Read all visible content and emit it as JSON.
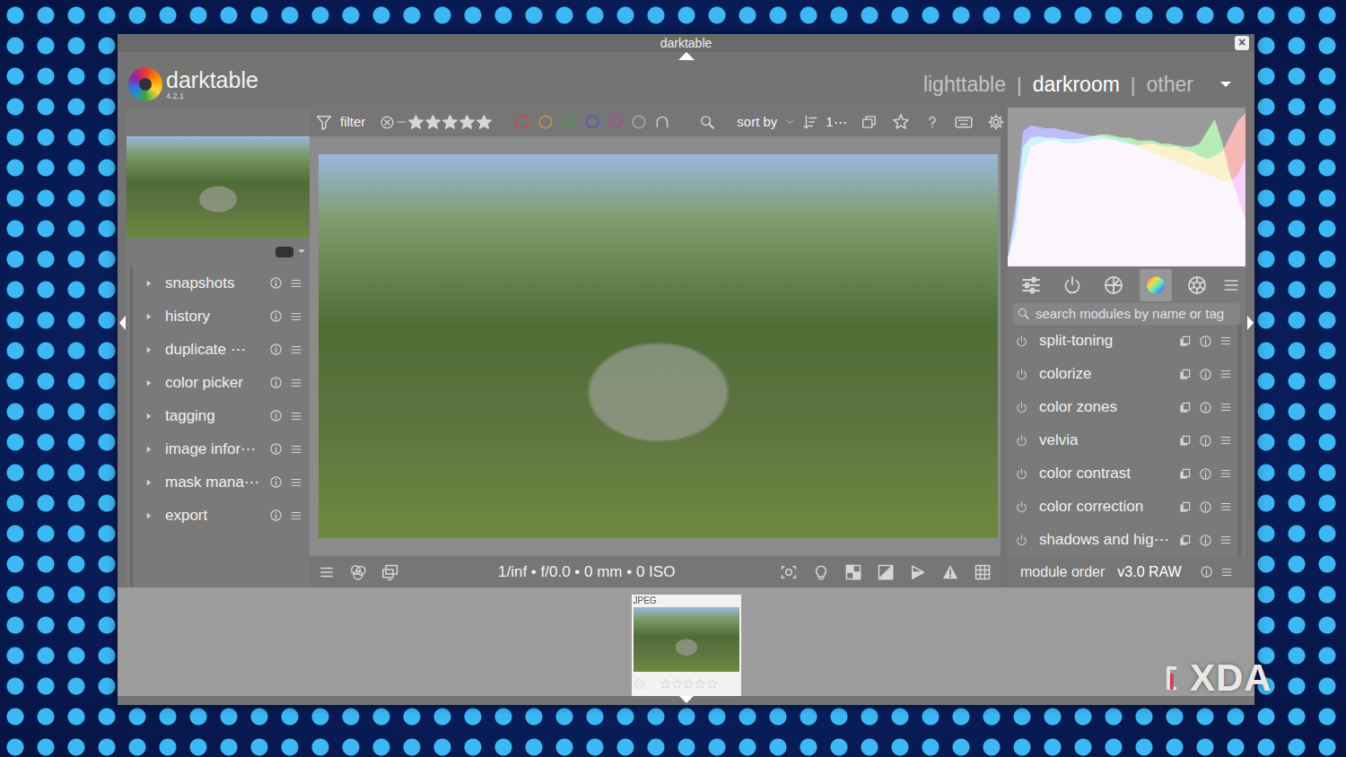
{
  "window": {
    "title": "darktable",
    "close": "×"
  },
  "app": {
    "name": "darktable",
    "version": "4.2.1"
  },
  "views": {
    "items": [
      {
        "label": "lighttable",
        "selected": false
      },
      {
        "label": "darkroom",
        "selected": true
      },
      {
        "label": "other",
        "selected": false
      }
    ],
    "separator": "|"
  },
  "left_panel": {
    "modules": [
      {
        "label": "snapshots",
        "expanded": false
      },
      {
        "label": "history",
        "expanded": false
      },
      {
        "label": "duplicate ⋯",
        "expanded": false
      },
      {
        "label": "color picker",
        "expanded": false
      },
      {
        "label": "tagging",
        "expanded": false
      },
      {
        "label": "image infor⋯",
        "expanded": false
      },
      {
        "label": "mask mana⋯",
        "expanded": false
      },
      {
        "label": "export",
        "expanded": false
      }
    ]
  },
  "toolbar": {
    "filter": "filter",
    "rating_filter": {
      "stars": 5
    },
    "color_labels": [
      {
        "color": "#c94848"
      },
      {
        "color": "#c8903a"
      },
      {
        "color": "#3f9a48"
      },
      {
        "color": "#4a5ab8"
      },
      {
        "color": "#b8429a"
      },
      {
        "color": "#a8a8a8"
      }
    ],
    "sort_by": "sort by",
    "sort_field": "1⋯"
  },
  "image_info": "1/inf • f/0.0 • 0 mm • 0 ISO",
  "histogram": {
    "series": [
      {
        "color": "#e84848",
        "values": [
          5,
          20,
          60,
          78,
          80,
          82,
          82,
          81,
          80,
          80,
          81,
          82,
          83,
          83,
          82,
          80,
          80,
          79,
          80,
          80,
          79,
          78,
          78,
          76,
          75,
          72,
          70,
          72,
          75,
          85,
          95,
          100
        ]
      },
      {
        "color": "#48d048",
        "values": [
          5,
          30,
          78,
          84,
          85,
          84,
          84,
          83,
          83,
          83,
          84,
          85,
          86,
          86,
          85,
          84,
          84,
          82,
          82,
          82,
          80,
          80,
          79,
          78,
          78,
          80,
          88,
          96,
          80,
          60,
          45,
          30
        ]
      },
      {
        "color": "#5858f0",
        "values": [
          5,
          40,
          88,
          92,
          91,
          90,
          90,
          89,
          88,
          87,
          86,
          85,
          85,
          84,
          83,
          82,
          80,
          78,
          76,
          74,
          72,
          70,
          68,
          66,
          64,
          62,
          60,
          58,
          56,
          55,
          60,
          70
        ]
      }
    ]
  },
  "module_groups": [
    {
      "kind": "quick",
      "selected": false
    },
    {
      "kind": "active",
      "selected": false
    },
    {
      "kind": "base",
      "selected": false
    },
    {
      "kind": "color",
      "selected": true
    },
    {
      "kind": "effect",
      "selected": false
    }
  ],
  "module_search": {
    "placeholder": "search modules by name or tag"
  },
  "modules": [
    {
      "label": "split-toning",
      "on": false
    },
    {
      "label": "colorize",
      "on": false
    },
    {
      "label": "color zones",
      "on": false
    },
    {
      "label": "velvia",
      "on": false
    },
    {
      "label": "color contrast",
      "on": false
    },
    {
      "label": "color correction",
      "on": false
    },
    {
      "label": "shadows and hig⋯",
      "on": false
    }
  ],
  "module_order": {
    "label": "module order",
    "value": "v3.0 RAW"
  },
  "filmstrip": {
    "items": [
      {
        "format": "JPEG",
        "stars": 0,
        "selected": true
      }
    ]
  },
  "watermark": "XDA"
}
